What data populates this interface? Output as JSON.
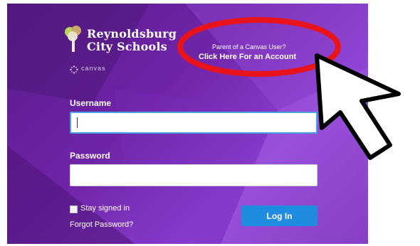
{
  "brand": {
    "school_line1": "Reynoldsburg",
    "school_line2": "City Schools",
    "product_name": "canvas",
    "logo_icon": "tree-icon",
    "product_icon": "canvas-dots-icon"
  },
  "parent_prompt": {
    "question": "Parent of a Canvas User?",
    "link_text": "Click Here For an Account"
  },
  "login_form": {
    "username_label": "Username",
    "username_value": "",
    "password_label": "Password",
    "password_value": "",
    "stay_signed_in_label": "Stay signed in",
    "stay_signed_in_checked": false,
    "forgot_password_text": "Forgot Password?",
    "login_button_label": "Log In"
  },
  "annotation": {
    "highlight_color": "#e8131b",
    "pointer_icon": "arrow-cursor-icon"
  },
  "colors": {
    "panel_purple": "#6f24a8",
    "button_blue": "#1f8ce0",
    "focus_blue": "#4aa3e0"
  }
}
